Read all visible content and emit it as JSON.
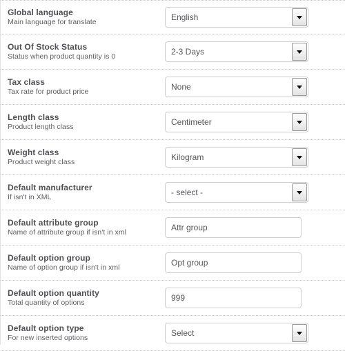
{
  "panel": {
    "name": "import-settings-panel"
  },
  "rows": [
    {
      "key": "global_language",
      "title": "Global language",
      "desc": "Main language for translate",
      "control": "select",
      "value": "English"
    },
    {
      "key": "out_of_stock_status",
      "title": "Out Of Stock Status",
      "desc": "Status when product quantity is 0",
      "control": "select",
      "value": "2-3 Days"
    },
    {
      "key": "tax_class",
      "title": "Tax class",
      "desc": "Tax rate for product price",
      "control": "select",
      "value": "None"
    },
    {
      "key": "length_class",
      "title": "Length class",
      "desc": "Product length class",
      "control": "select",
      "value": "Centimeter"
    },
    {
      "key": "weight_class",
      "title": "Weight class",
      "desc": "Product weight class",
      "control": "select",
      "value": "Kilogram"
    },
    {
      "key": "default_manufacturer",
      "title": "Default manufacturer",
      "desc": "If isn't in XML",
      "control": "select",
      "value": "- select -"
    },
    {
      "key": "default_attribute_group",
      "title": "Default attribute group",
      "desc": "Name of attribute group if isn't in xml",
      "control": "text",
      "value": "Attr group"
    },
    {
      "key": "default_option_group",
      "title": "Default option group",
      "desc": "Name of option group if isn't in xml",
      "control": "text",
      "value": "Opt group"
    },
    {
      "key": "default_option_quantity",
      "title": "Default option quantity",
      "desc": "Total quantity of options",
      "control": "text",
      "value": "999"
    },
    {
      "key": "default_option_type",
      "title": "Default option type",
      "desc": "For new inserted options",
      "control": "select",
      "value": "Select"
    }
  ],
  "colors": {
    "title_text": "#4f4f56",
    "desc_text": "#5e5e63",
    "value_text": "#55555c",
    "field_border": "#cfcfcf",
    "separator": "#c9c9c9",
    "background": "#ffffff"
  }
}
